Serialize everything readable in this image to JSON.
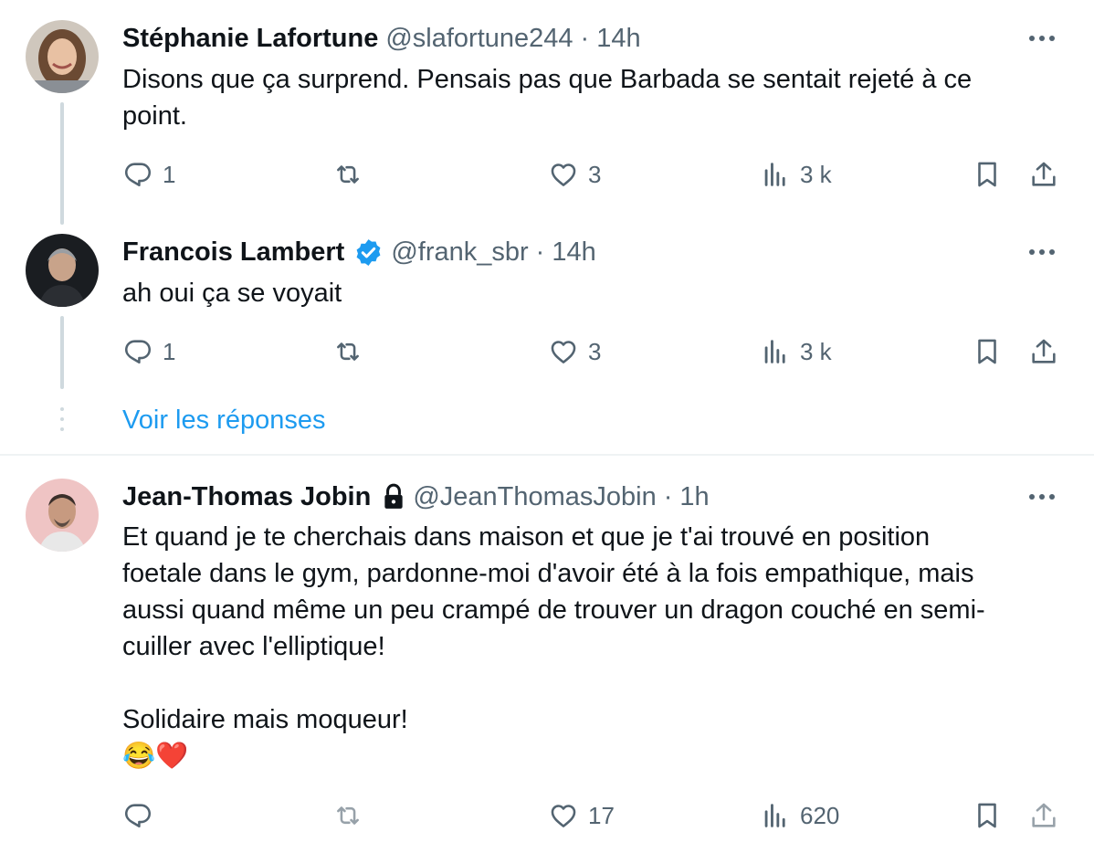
{
  "tweets": [
    {
      "name": "Stéphanie Lafortune",
      "handle": "@slafortune244",
      "sep": "·",
      "time": "14h",
      "text": "Disons que ça surprend. Pensais pas que Barbada se sentait rejeté à ce point.",
      "replies": "1",
      "retweets": "",
      "likes": "3",
      "views": "3 k"
    },
    {
      "name": "Francois Lambert",
      "handle": "@frank_sbr",
      "sep": "·",
      "time": "14h",
      "verified": true,
      "text": "ah oui ça se voyait",
      "replies": "1",
      "retweets": "",
      "likes": "3",
      "views": "3 k"
    },
    {
      "name": "Jean-Thomas Jobin",
      "handle": "@JeanThomasJobin",
      "sep": "·",
      "time": "1h",
      "protected": true,
      "text_lines": [
        "Et quand je te cherchais dans maison et que je t'ai trouvé en position",
        "foetale dans le gym, pardonne-moi d'avoir été à la fois empathique, mais",
        "aussi quand même un peu crampé de trouver un dragon couché en semi-",
        "cuiller avec l'elliptique!"
      ],
      "text2": "Solidaire mais moqueur!",
      "emoji": "😂❤️",
      "replies": "",
      "retweets": "",
      "likes": "17",
      "views": "620"
    }
  ],
  "show_replies_label": "Voir les réponses",
  "colors": {
    "accent": "#1d9bf0",
    "secondary_text": "#536471",
    "thread_line": "#cfd9de"
  },
  "icons": [
    "more-icon",
    "reply-icon",
    "retweet-icon",
    "like-icon",
    "views-icon",
    "bookmark-icon",
    "share-icon",
    "verified-badge-icon",
    "lock-icon"
  ]
}
